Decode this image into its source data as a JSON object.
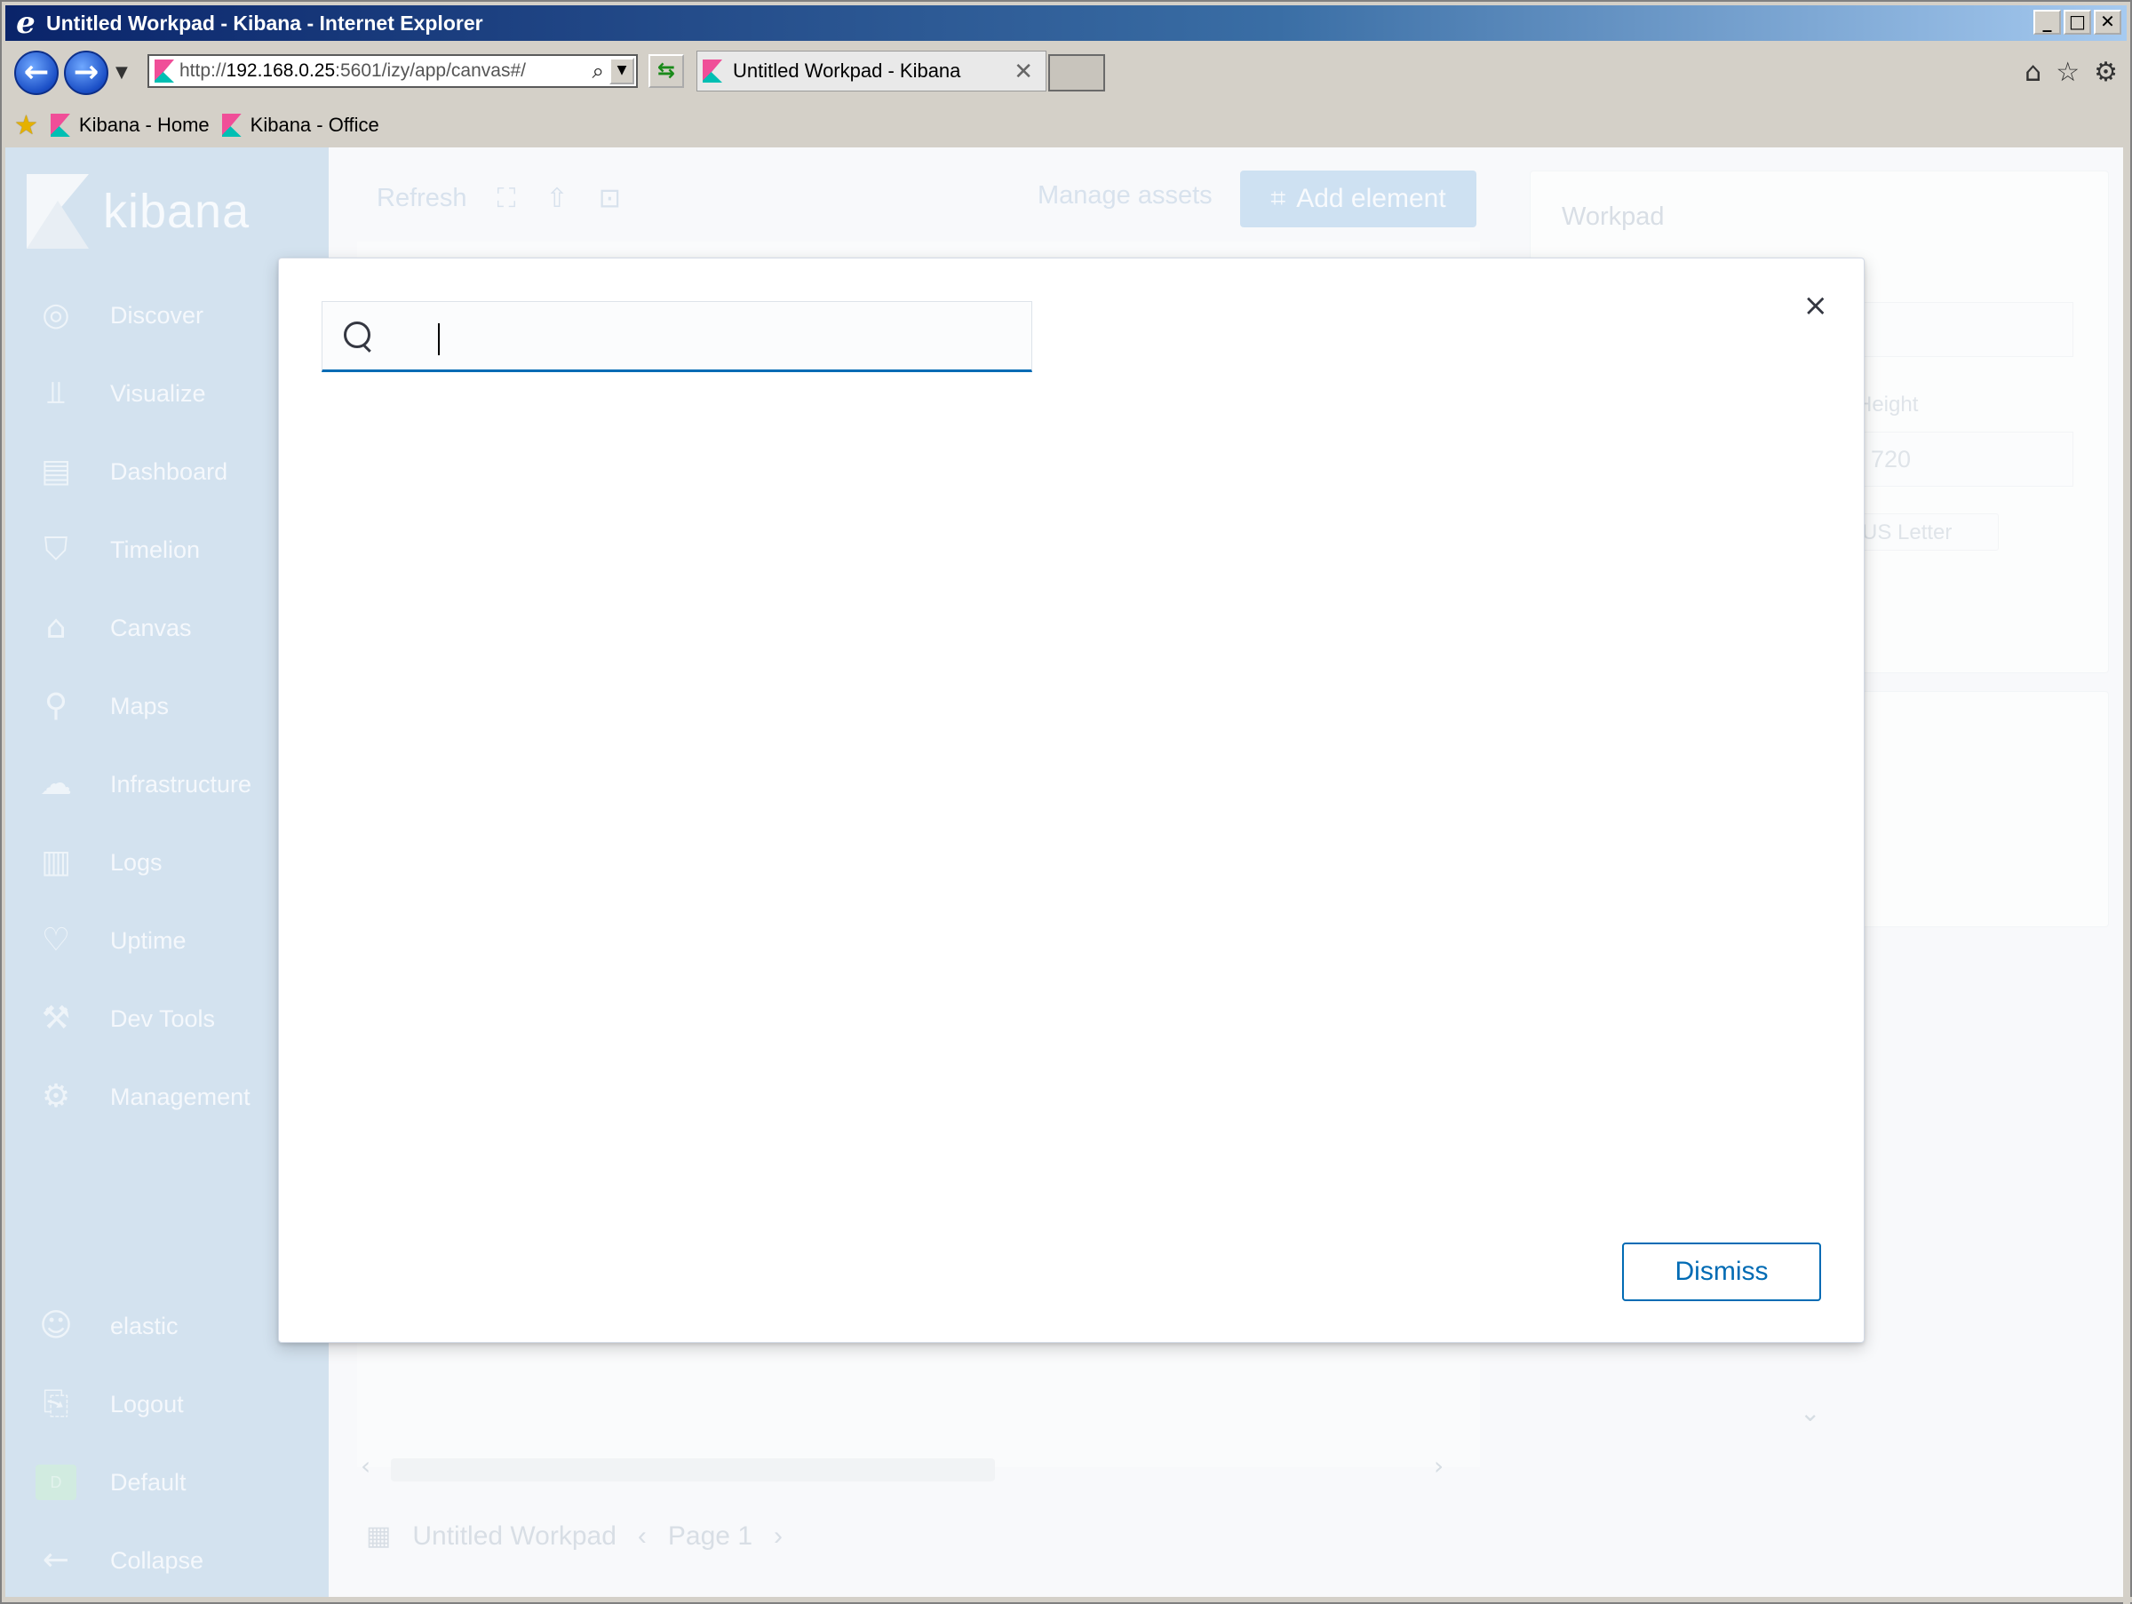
{
  "window": {
    "title": "Untitled Workpad - Kibana - Internet Explorer",
    "min": "_",
    "max": "□",
    "close": "✕"
  },
  "browser": {
    "address_prefix": "http://",
    "address_host": "192.168.0.25",
    "address_rest": ":5601/izy/app/canvas#/",
    "tab_label": "Untitled Workpad - Kibana",
    "tab_close": "✕"
  },
  "favorites": [
    {
      "label": "Kibana - Home"
    },
    {
      "label": "Kibana - Office"
    }
  ],
  "sidenav": {
    "brand": "kibana",
    "items": [
      {
        "label": "Discover",
        "icon": "compass-icon"
      },
      {
        "label": "Visualize",
        "icon": "visualize-icon"
      },
      {
        "label": "Dashboard",
        "icon": "dashboard-icon"
      },
      {
        "label": "Timelion",
        "icon": "timelion-icon"
      },
      {
        "label": "Canvas",
        "icon": "canvas-icon"
      },
      {
        "label": "Maps",
        "icon": "maps-icon"
      },
      {
        "label": "Infrastructure",
        "icon": "infrastructure-icon"
      },
      {
        "label": "Logs",
        "icon": "logs-icon"
      },
      {
        "label": "Uptime",
        "icon": "heart-icon"
      },
      {
        "label": "Dev Tools",
        "icon": "wrench-icon"
      },
      {
        "label": "Management",
        "icon": "gear-icon"
      }
    ],
    "footer": [
      {
        "label": "elastic",
        "icon": "user-icon"
      },
      {
        "label": "Logout",
        "icon": "logout-icon"
      },
      {
        "label": "Default",
        "badge": "D"
      },
      {
        "label": "Collapse",
        "icon": "arrow-left-icon"
      }
    ]
  },
  "canvas": {
    "refresh": "Refresh",
    "manage_assets": "Manage assets",
    "add_element": "Add element",
    "workpad_title": "Untitled Workpad",
    "page_label": "Page 1",
    "panel_title": "Workpad",
    "height_label": "Height",
    "height_value": "720",
    "preset_label": "US Letter"
  },
  "modal": {
    "search_value": "",
    "dismiss": "Dismiss",
    "close": "×"
  }
}
